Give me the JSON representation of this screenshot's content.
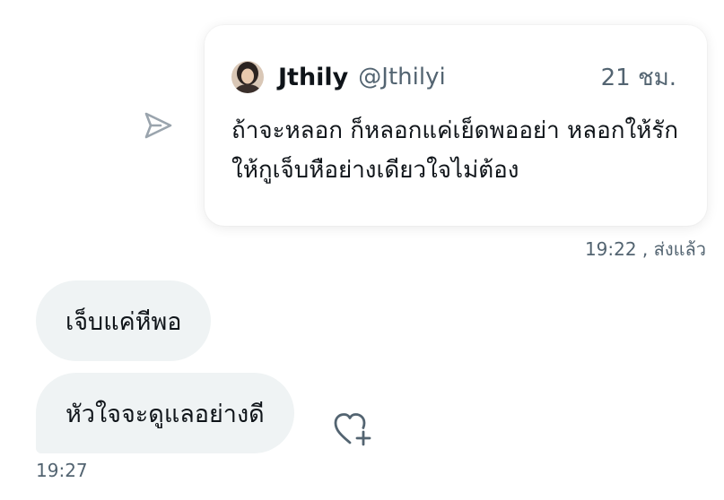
{
  "quote": {
    "author_name": "Jthily",
    "author_handle": "@Jthilyi",
    "time": "21 ชม.",
    "text": "ถ้าจะหลอก ก็หลอกแค่เย็ดพออย่า หลอกให้รัก ให้กูเจ็บหือย่างเดียวใจไม่ต้อง"
  },
  "sent_status": "19:22 , ส่งแล้ว",
  "messages": [
    {
      "text": "เจ็บแค่หีพอ"
    },
    {
      "text": "หัวใจจะดูแลอย่างดี"
    }
  ],
  "received_time": "19:27",
  "icons": {
    "share": "share-forward-icon",
    "react": "heart-plus-icon",
    "avatar": "avatar"
  },
  "colors": {
    "text_primary": "#0f1419",
    "text_secondary": "#536471",
    "bubble_bg": "#eff3f4",
    "icon_gray": "#9aa4ad"
  }
}
